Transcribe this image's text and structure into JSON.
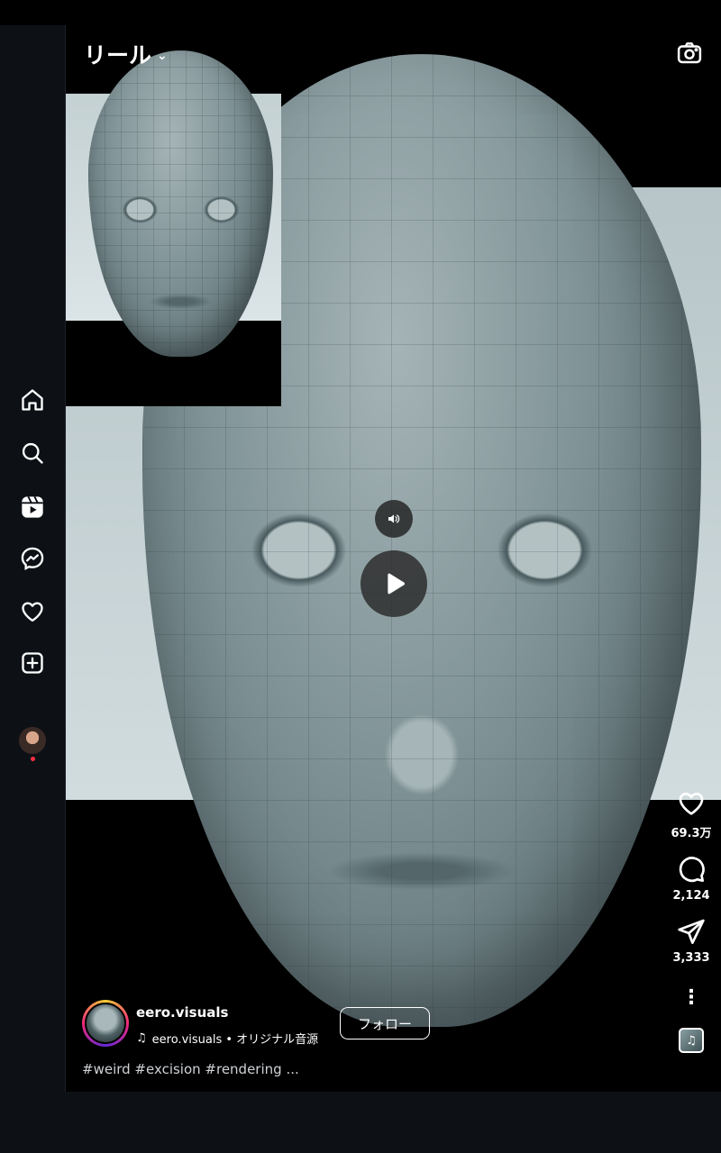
{
  "header": {
    "title": "リール"
  },
  "sidebar": {
    "items": [
      {
        "name": "home"
      },
      {
        "name": "search"
      },
      {
        "name": "reels"
      },
      {
        "name": "messenger"
      },
      {
        "name": "notifications"
      },
      {
        "name": "create"
      },
      {
        "name": "profile"
      }
    ]
  },
  "reel": {
    "likes": "69.3万",
    "comments": "2,124",
    "shares": "3,333",
    "username": "eero.visuals",
    "audio": "eero.visuals • オリジナル音源",
    "follow_label": "フォロー",
    "caption": "#weird #excision #rendering ..."
  },
  "icons": {
    "home": "home-icon",
    "search": "search-icon",
    "reels": "reels-icon",
    "messenger": "messenger-icon",
    "heart": "heart-icon",
    "create": "plus-square-icon",
    "camera": "camera-icon",
    "comment": "comment-icon",
    "share": "paper-plane-icon",
    "more": "more-vertical-icon",
    "music": "music-note-icon",
    "mute": "speaker-icon",
    "play": "play-icon"
  },
  "colors": {
    "sidebar_bg": "#0d1116",
    "notif_dot": "#ff3040"
  }
}
